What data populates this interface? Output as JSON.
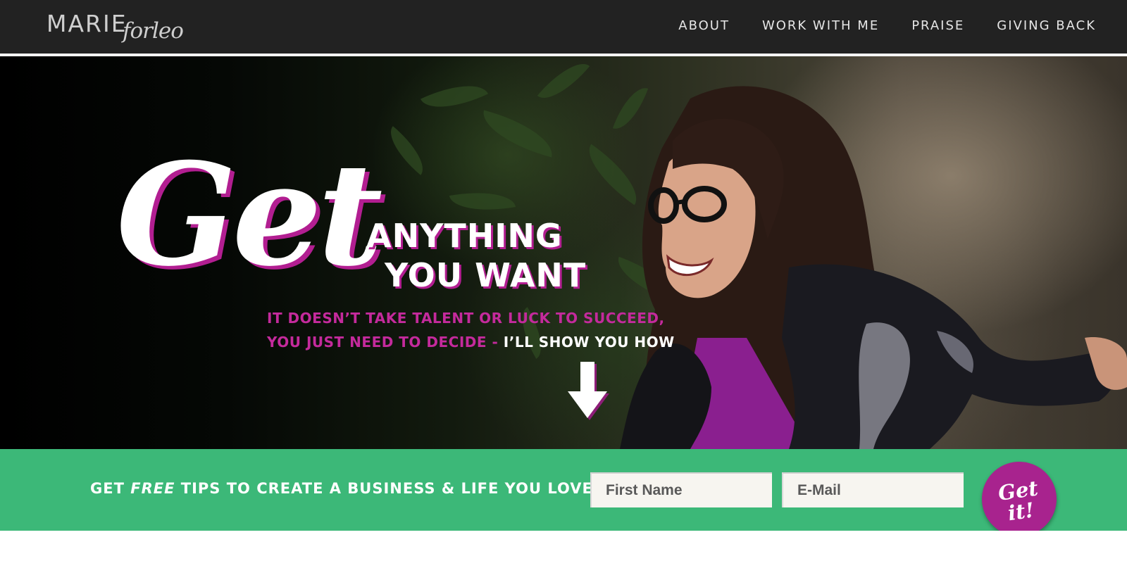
{
  "header": {
    "logo_main": "MARIE",
    "logo_script": "forleo",
    "nav": [
      "ABOUT",
      "WORK WITH ME",
      "PRAISE",
      "GIVING BACK"
    ]
  },
  "hero": {
    "headline_script": "Get",
    "headline_line1": "ANYTHING",
    "headline_line2": "YOU WANT",
    "subtitle_line1": "IT DOESN’T TAKE TALENT OR LUCK TO SUCCEED,",
    "subtitle_line2_pink": "YOU JUST NEED TO DECIDE - ",
    "subtitle_line2_white": "I’LL SHOW YOU HOW",
    "arrow_icon": "down-arrow-icon"
  },
  "optin": {
    "text_before": "GET ",
    "text_emphasis": "FREE",
    "text_after": " TIPS TO CREATE A BUSINESS & LIFE YOU LOVE",
    "first_name_placeholder": "First Name",
    "email_placeholder": "E-Mail",
    "button_line1": "Get",
    "button_line2": "it!"
  },
  "colors": {
    "header_bg": "#222222",
    "accent_magenta": "#b21e91",
    "optin_green": "#3cb878",
    "button_purple": "#a8238e"
  }
}
